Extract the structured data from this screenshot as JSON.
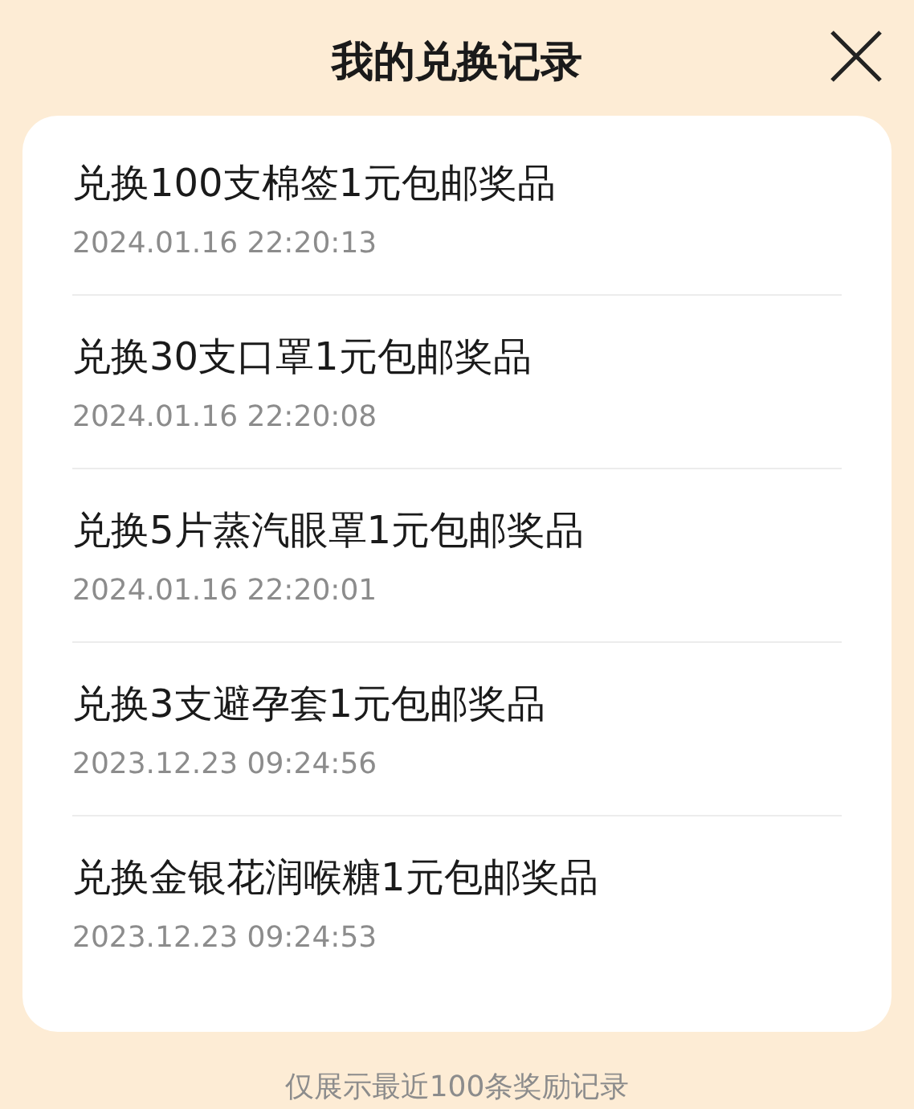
{
  "header": {
    "title": "我的兑换记录"
  },
  "records": [
    {
      "title": "兑换100支棉签1元包邮奖品",
      "time": "2024.01.16 22:20:13"
    },
    {
      "title": "兑换30支口罩1元包邮奖品",
      "time": "2024.01.16 22:20:08"
    },
    {
      "title": "兑换5片蒸汽眼罩1元包邮奖品",
      "time": "2024.01.16 22:20:01"
    },
    {
      "title": "兑换3支避孕套1元包邮奖品",
      "time": "2023.12.23 09:24:56"
    },
    {
      "title": "兑换金银花润喉糖1元包邮奖品",
      "time": "2023.12.23 09:24:53"
    }
  ],
  "footer": "仅展示最近100条奖励记录"
}
